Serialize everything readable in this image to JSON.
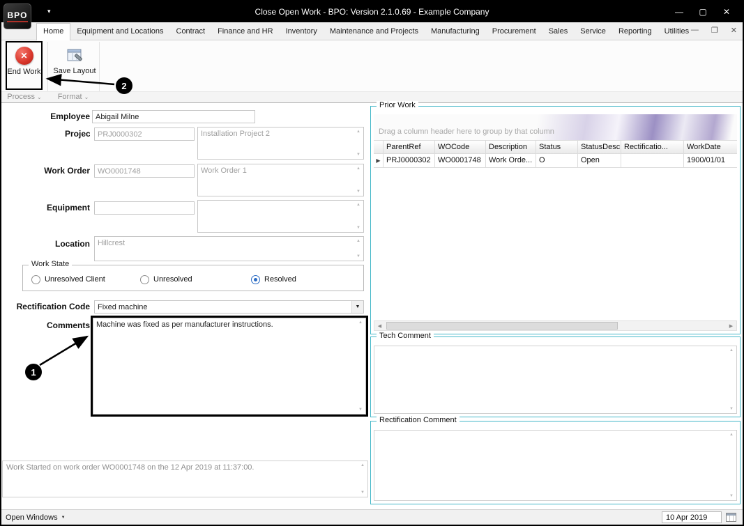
{
  "window": {
    "title": "Close Open Work - BPO: Version 2.1.0.69 - Example Company",
    "logo_text": "BPO",
    "controls": {
      "minimize": "—",
      "maximize": "▢",
      "close": "✕"
    }
  },
  "tabstrip": {
    "tabs": [
      {
        "label": "Home"
      },
      {
        "label": "Equipment and Locations"
      },
      {
        "label": "Contract"
      },
      {
        "label": "Finance and HR"
      },
      {
        "label": "Inventory"
      },
      {
        "label": "Maintenance and Projects"
      },
      {
        "label": "Manufacturing"
      },
      {
        "label": "Procurement"
      },
      {
        "label": "Sales"
      },
      {
        "label": "Service"
      },
      {
        "label": "Reporting"
      },
      {
        "label": "Utilities"
      }
    ],
    "mdi": {
      "minimize": "—",
      "restore": "❐",
      "close": "✕"
    }
  },
  "ribbon": {
    "end_work": "End Work",
    "save_layout": "Save Layout",
    "groups": {
      "process": "Process",
      "format": "Format"
    }
  },
  "annotations": {
    "one": "1",
    "two": "2"
  },
  "icons": {
    "end_work_x": "✕",
    "qat_chevron": "▾",
    "group_chevron": "⌄",
    "spin_up": "▲",
    "spin_down": "▼",
    "dropdown": "▼",
    "row_indicator": "▶",
    "scroll_left": "◀",
    "scroll_right": "▶",
    "open_windows_caret": "▼"
  },
  "form": {
    "employee": {
      "label": "Employee",
      "value": "Abigail Milne"
    },
    "project": {
      "label": "Project",
      "code": "PRJ0000302",
      "description": "Installation Project 2"
    },
    "work_order": {
      "label": "Work Order",
      "code": "WO0001748",
      "description": "Work Order 1"
    },
    "equipment": {
      "label": "Equipment",
      "code": "",
      "description": ""
    },
    "location": {
      "label": "Location",
      "value": "Hillcrest"
    },
    "work_state": {
      "label": "Work State",
      "options": [
        {
          "label": "Unresolved Client",
          "selected": false
        },
        {
          "label": "Unresolved",
          "selected": false
        },
        {
          "label": "Resolved",
          "selected": true
        }
      ]
    },
    "rectification_code": {
      "label": "Rectification Code",
      "value": "Fixed machine"
    },
    "comments": {
      "label": "Comments",
      "value": "Machine was fixed as per manufacturer instructions."
    },
    "status_note": "Work Started on work order WO0001748 on the 12 Apr 2019 at 11:37:00."
  },
  "prior_work": {
    "title": "Prior Work",
    "group_hint": "Drag a column header here to group by that column",
    "columns": [
      "ParentRef",
      "WOCode",
      "Description",
      "Status",
      "StatusDesc",
      "Rectificatio...",
      "WorkDate"
    ],
    "rows": [
      [
        "PRJ0000302",
        "WO0001748",
        "Work Orde...",
        "O",
        "Open",
        "",
        "1900/01/01"
      ]
    ]
  },
  "tech_comment": {
    "title": "Tech Comment",
    "value": ""
  },
  "rectification_comment": {
    "title": "Rectification Comment",
    "value": ""
  },
  "status_bar": {
    "open_windows": "Open Windows",
    "date": "10 Apr 2019"
  }
}
